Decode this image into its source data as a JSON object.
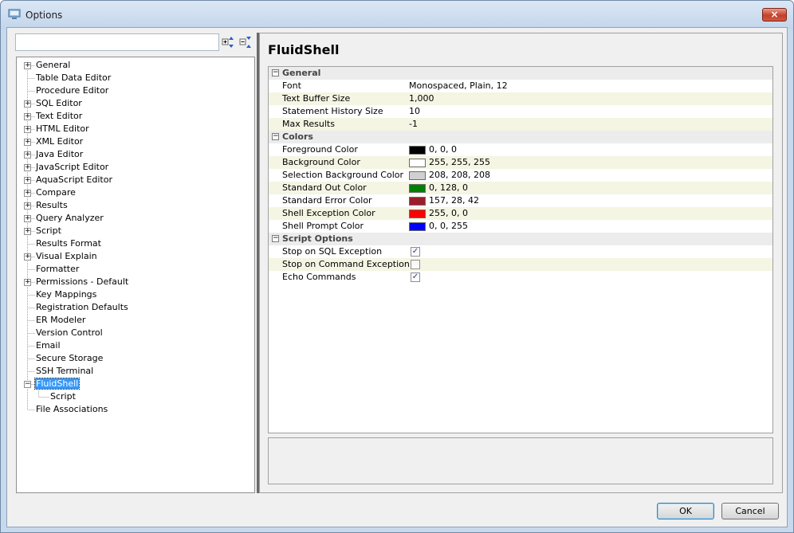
{
  "window": {
    "title": "Options",
    "close_symbol": "×"
  },
  "left": {
    "search": {
      "value": "",
      "placeholder": ""
    },
    "tree": [
      {
        "label": "General",
        "level": 0,
        "expander": "plus"
      },
      {
        "label": "Table Data Editor",
        "level": 0,
        "expander": "none"
      },
      {
        "label": "Procedure Editor",
        "level": 0,
        "expander": "none"
      },
      {
        "label": "SQL Editor",
        "level": 0,
        "expander": "plus"
      },
      {
        "label": "Text Editor",
        "level": 0,
        "expander": "plus"
      },
      {
        "label": "HTML Editor",
        "level": 0,
        "expander": "plus"
      },
      {
        "label": "XML Editor",
        "level": 0,
        "expander": "plus"
      },
      {
        "label": "Java Editor",
        "level": 0,
        "expander": "plus"
      },
      {
        "label": "JavaScript Editor",
        "level": 0,
        "expander": "plus"
      },
      {
        "label": "AquaScript Editor",
        "level": 0,
        "expander": "plus"
      },
      {
        "label": "Compare",
        "level": 0,
        "expander": "plus"
      },
      {
        "label": "Results",
        "level": 0,
        "expander": "plus"
      },
      {
        "label": "Query Analyzer",
        "level": 0,
        "expander": "plus"
      },
      {
        "label": "Script",
        "level": 0,
        "expander": "plus"
      },
      {
        "label": "Results Format",
        "level": 0,
        "expander": "none"
      },
      {
        "label": "Visual Explain",
        "level": 0,
        "expander": "plus"
      },
      {
        "label": "Formatter",
        "level": 0,
        "expander": "none"
      },
      {
        "label": "Permissions - Default",
        "level": 0,
        "expander": "plus"
      },
      {
        "label": "Key Mappings",
        "level": 0,
        "expander": "none"
      },
      {
        "label": "Registration Defaults",
        "level": 0,
        "expander": "none"
      },
      {
        "label": "ER Modeler",
        "level": 0,
        "expander": "none"
      },
      {
        "label": "Version Control",
        "level": 0,
        "expander": "none"
      },
      {
        "label": "Email",
        "level": 0,
        "expander": "none"
      },
      {
        "label": "Secure Storage",
        "level": 0,
        "expander": "none"
      },
      {
        "label": "SSH Terminal",
        "level": 0,
        "expander": "none"
      },
      {
        "label": "FluidShell",
        "level": 0,
        "expander": "minus",
        "selected": true
      },
      {
        "label": "Script",
        "level": 1,
        "expander": "none"
      },
      {
        "label": "File Associations",
        "level": 0,
        "expander": "none"
      }
    ]
  },
  "right": {
    "title": "FluidShell",
    "groups": [
      {
        "name": "General",
        "rows": [
          {
            "name": "Font",
            "value": "Monospaced, Plain, 12"
          },
          {
            "name": "Text Buffer Size",
            "value": "1,000"
          },
          {
            "name": "Statement History Size",
            "value": "10"
          },
          {
            "name": "Max Results",
            "value": "-1"
          }
        ]
      },
      {
        "name": "Colors",
        "rows": [
          {
            "name": "Foreground Color",
            "value": "0, 0, 0",
            "color": "#000000"
          },
          {
            "name": "Background Color",
            "value": "255, 255, 255",
            "color": "#ffffff"
          },
          {
            "name": "Selection Background Color",
            "value": "208, 208, 208",
            "color": "#d0d0d0"
          },
          {
            "name": "Standard Out Color",
            "value": "0, 128, 0",
            "color": "#008000"
          },
          {
            "name": "Standard Error Color",
            "value": "157, 28, 42",
            "color": "#9d1c2a"
          },
          {
            "name": "Shell Exception Color",
            "value": "255, 0, 0",
            "color": "#ff0000"
          },
          {
            "name": "Shell Prompt Color",
            "value": "0, 0, 255",
            "color": "#0000ff"
          }
        ]
      },
      {
        "name": "Script Options",
        "rows": [
          {
            "name": "Stop on SQL Exception",
            "checked": true
          },
          {
            "name": "Stop on Command Exception",
            "checked": false
          },
          {
            "name": "Echo Commands",
            "checked": true
          }
        ]
      }
    ],
    "description": ""
  },
  "buttons": {
    "ok": "OK",
    "cancel": "Cancel"
  }
}
